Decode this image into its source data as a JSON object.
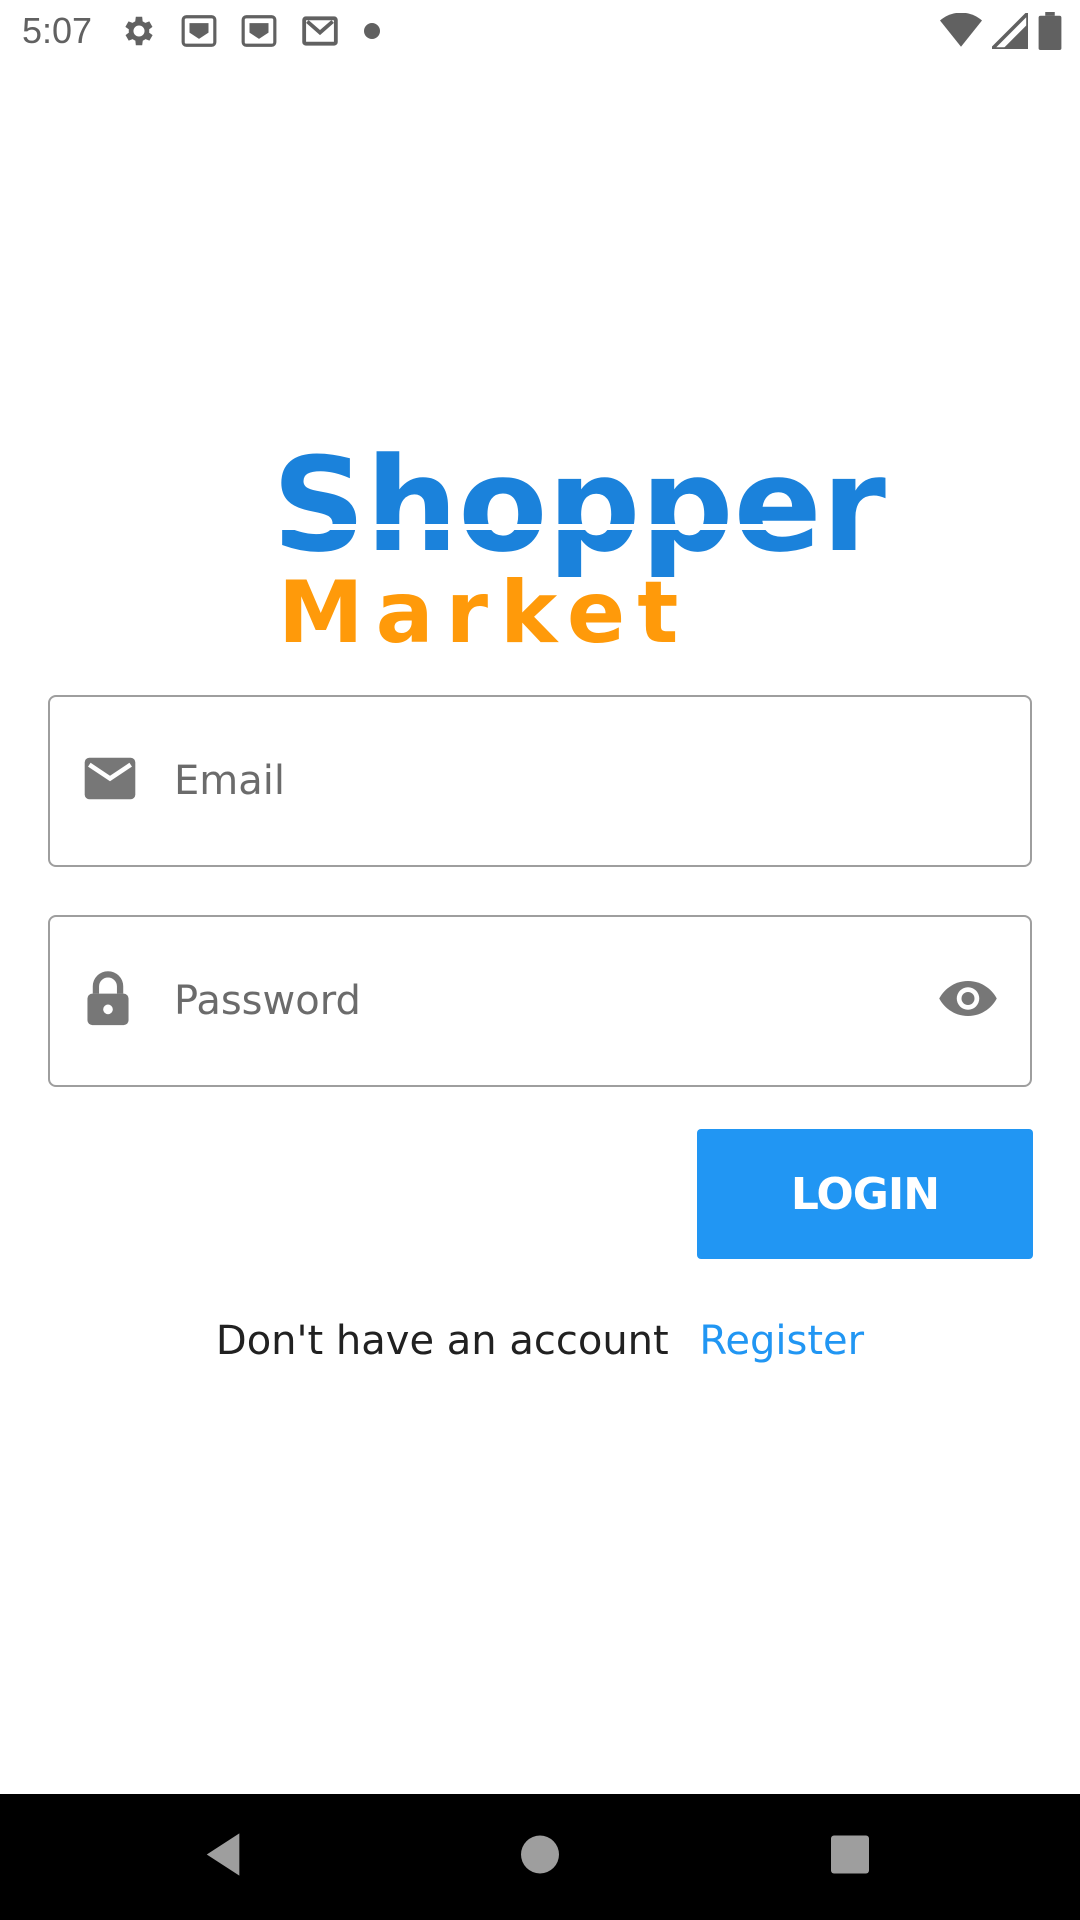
{
  "status_bar": {
    "time": "5:07",
    "left_icons": [
      "settings-icon",
      "notification-icon",
      "notification-icon",
      "gmail-icon",
      "dot-icon"
    ],
    "right_icons": [
      "wifi-icon",
      "signal-icon",
      "battery-icon"
    ]
  },
  "logo": {
    "top_text": "Shopper",
    "bottom_text": "Market",
    "top_color": "#1b82db",
    "bottom_color": "#ff9a0a"
  },
  "form": {
    "email": {
      "placeholder": "Email",
      "value": "",
      "icon": "mail-icon"
    },
    "password": {
      "placeholder": "Password",
      "value": "",
      "icon": "lock-icon",
      "toggle_icon": "eye-icon"
    },
    "login_label": "LOGIN"
  },
  "register": {
    "prompt": "Don't have an account",
    "link": "Register"
  },
  "nav_bar": {
    "buttons": [
      "back-icon",
      "home-icon",
      "recents-icon"
    ]
  },
  "colors": {
    "accent": "#2196f3",
    "field_border": "#9e9e9e",
    "nav_bg": "#000000"
  }
}
